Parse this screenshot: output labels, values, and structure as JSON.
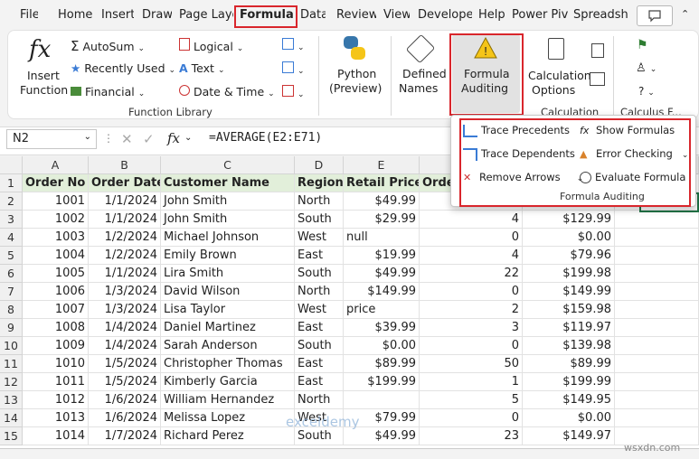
{
  "tabs": [
    "File",
    "Home",
    "Insert",
    "Draw",
    "Page Layo",
    "Formulas",
    "Data",
    "Review",
    "View",
    "Developer",
    "Help",
    "Power Pivot",
    "Spreadshe"
  ],
  "active_tab": "Formulas",
  "ribbon": {
    "insert_function": [
      "Insert",
      "Function"
    ],
    "autosum": "AutoSum",
    "recently_used": "Recently Used",
    "financial": "Financial",
    "logical": "Logical",
    "text": "Text",
    "date_time": "Date & Time",
    "python": [
      "Python",
      "(Preview)"
    ],
    "defined_names": [
      "Defined",
      "Names"
    ],
    "formula_auditing": [
      "Formula",
      "Auditing"
    ],
    "calc_options": [
      "Calculation",
      "Options"
    ],
    "function_library_label": "Function Library",
    "calculation_label": "Calculation",
    "calculus_label": "Calculus F..."
  },
  "formula_bar": {
    "name_box": "N2",
    "fx": "fx",
    "formula": "=AVERAGE(E2:E71)"
  },
  "auditing_popup": {
    "trace_precedents": "Trace Precedents",
    "trace_dependents": "Trace Dependents",
    "remove_arrows": "Remove Arrows",
    "show_formulas": "Show Formulas",
    "error_checking": "Error Checking",
    "evaluate_formula": "Evaluate Formula",
    "group_label": "Formula Auditing"
  },
  "columns": [
    "A",
    "B",
    "C",
    "D",
    "E",
    "F",
    "G"
  ],
  "header_row": [
    "Order No",
    "Order Date",
    "Customer Name",
    "Region",
    "Retail Price",
    "Orde",
    ""
  ],
  "rows": [
    [
      "1001",
      "1/1/2024",
      "John Smith",
      "North",
      "$49.99",
      "",
      ""
    ],
    [
      "1002",
      "1/1/2024",
      "John Smith",
      "South",
      "$29.99",
      "4",
      "$129.99"
    ],
    [
      "1003",
      "1/2/2024",
      "Michael Johnson",
      "West",
      "null",
      "0",
      "$0.00"
    ],
    [
      "1004",
      "1/2/2024",
      "Emily Brown",
      "East",
      "$19.99",
      "4",
      "$79.96"
    ],
    [
      "1005",
      "1/1/2024",
      "Lira Smith",
      "South",
      "$49.99",
      "22",
      "$199.98"
    ],
    [
      "1006",
      "1/3/2024",
      "David Wilson",
      "North",
      "$149.99",
      "0",
      "$149.99"
    ],
    [
      "1007",
      "1/3/2024",
      "Lisa Taylor",
      "West",
      "price",
      "2",
      "$159.98"
    ],
    [
      "1008",
      "1/4/2024",
      "Daniel Martinez",
      "East",
      "$39.99",
      "3",
      "$119.97"
    ],
    [
      "1009",
      "1/4/2024",
      "Sarah Anderson",
      "South",
      "$0.00",
      "0",
      "$139.98"
    ],
    [
      "1010",
      "1/5/2024",
      "Christopher Thomas",
      "East",
      "$89.99",
      "50",
      "$89.99"
    ],
    [
      "1011",
      "1/5/2024",
      "Kimberly Garcia",
      "East",
      "$199.99",
      "1",
      "$199.99"
    ],
    [
      "1012",
      "1/6/2024",
      "William Hernandez",
      "North",
      "",
      "5",
      "$149.95"
    ],
    [
      "1013",
      "1/6/2024",
      "Melissa Lopez",
      "West",
      "$79.99",
      "0",
      "$0.00"
    ],
    [
      "1014",
      "1/7/2024",
      "Richard Perez",
      "South",
      "$49.99",
      "23",
      "$149.97"
    ]
  ],
  "watermark": "exceldemy",
  "watermark2": "wsxdn.com"
}
